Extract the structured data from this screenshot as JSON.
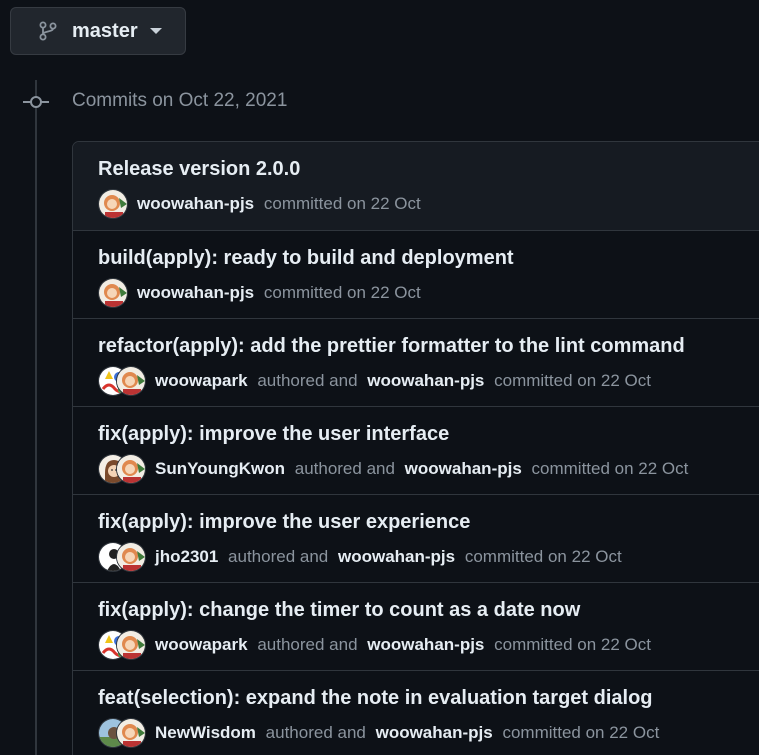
{
  "branch": {
    "name": "master",
    "icon": "git-branch-icon"
  },
  "group": {
    "title": "Commits on Oct 22, 2021"
  },
  "commits": [
    {
      "title": "Release version 2.0.0",
      "author": "woowahan-pjs",
      "committed_text": "committed on 22 Oct"
    },
    {
      "title": "build(apply): ready to build and deployment",
      "author": "woowahan-pjs",
      "committed_text": "committed on 22 Oct"
    },
    {
      "title": "refactor(apply): add the prettier formatter to the lint command",
      "author": "woowapark",
      "authored_text": "authored and",
      "committer": "woowahan-pjs",
      "committed_text": "committed on 22 Oct"
    },
    {
      "title": "fix(apply): improve the user interface",
      "author": "SunYoungKwon",
      "authored_text": "authored and",
      "committer": "woowahan-pjs",
      "committed_text": "committed on 22 Oct"
    },
    {
      "title": "fix(apply): improve the user experience",
      "author": "jho2301",
      "authored_text": "authored and",
      "committer": "woowahan-pjs",
      "committed_text": "committed on 22 Oct"
    },
    {
      "title": "fix(apply): change the timer to count as a date now",
      "author": "woowapark",
      "authored_text": "authored and",
      "committer": "woowahan-pjs",
      "committed_text": "committed on 22 Oct"
    },
    {
      "title": "feat(selection): expand the note in evaluation target dialog",
      "author": "NewWisdom",
      "authored_text": "authored and",
      "committer": "woowahan-pjs",
      "committed_text": "committed on 22 Oct"
    }
  ]
}
